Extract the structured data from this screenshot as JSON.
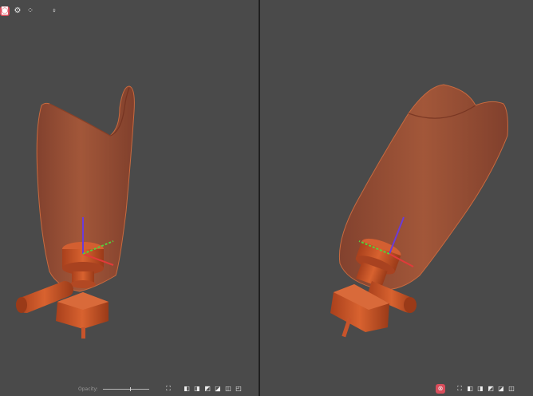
{
  "top_toolbar": {
    "buttons": [
      {
        "name": "view-mode-icon",
        "glyph": "◙",
        "active": true
      },
      {
        "name": "settings-gear-icon",
        "glyph": "⚙",
        "active": false
      },
      {
        "name": "points-grid-icon",
        "glyph": "⁘",
        "active": false
      },
      {
        "name": "pivot-tool-icon",
        "glyph": "⍖",
        "active": false
      }
    ]
  },
  "left_viewport": {
    "opacity_label": "Opacity:",
    "opacity_value": 0.6,
    "view_buttons": [
      {
        "name": "fit-view-icon",
        "glyph": "⛶"
      },
      {
        "name": "view-cube-front-icon",
        "glyph": "◧"
      },
      {
        "name": "view-cube-back-icon",
        "glyph": "◨"
      },
      {
        "name": "view-cube-left-icon",
        "glyph": "◩"
      },
      {
        "name": "view-cube-right-icon",
        "glyph": "◪"
      },
      {
        "name": "view-cube-top-icon",
        "glyph": "◫"
      },
      {
        "name": "view-cube-iso-icon",
        "glyph": "◰"
      }
    ]
  },
  "right_viewport": {
    "view_buttons": [
      {
        "name": "link-views-icon",
        "glyph": "⊗",
        "active": true
      },
      {
        "name": "fit-view-icon",
        "glyph": "⛶"
      },
      {
        "name": "view-cube-front-icon",
        "glyph": "◧"
      },
      {
        "name": "view-cube-back-icon",
        "glyph": "◨"
      },
      {
        "name": "view-cube-left-icon",
        "glyph": "◩"
      },
      {
        "name": "view-cube-right-icon",
        "glyph": "◪"
      },
      {
        "name": "view-cube-top-icon",
        "glyph": "◫"
      }
    ]
  },
  "colors": {
    "background": "#4a4a4a",
    "socket": "#b0532f",
    "socket_edge": "#c96a3f",
    "part": "#c8542b",
    "part_dark": "#8e3619",
    "accent_active": "#d94d5b",
    "axis_x": "#e13a3a",
    "axis_y": "#55d03c",
    "axis_z": "#6a3cd8"
  }
}
